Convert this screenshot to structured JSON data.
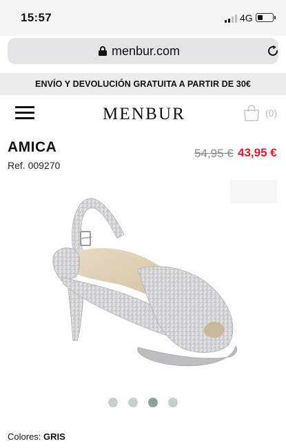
{
  "status_bar": {
    "time": "15:57",
    "network": "4G",
    "battery_level": 0.25
  },
  "browser": {
    "url": "menbur.com"
  },
  "banner": {
    "text": "ENVÍO Y DEVOLUCIÓN GRATUITA A PARTIR DE 30€"
  },
  "header": {
    "logo": "MENBUR",
    "cart_count": "(0)"
  },
  "product": {
    "name": "AMICA",
    "ref": "Ref. 009270",
    "old_price": "54,95 €",
    "price": "43,95 €",
    "colors_label": "Colores:",
    "colors_value": "GRIS"
  },
  "carousel": {
    "count": 4,
    "active_index": 2
  },
  "colors": {
    "price_accent": "#d81e2c",
    "dot": "#c4cfcc",
    "dot_active": "#8ea19c"
  }
}
